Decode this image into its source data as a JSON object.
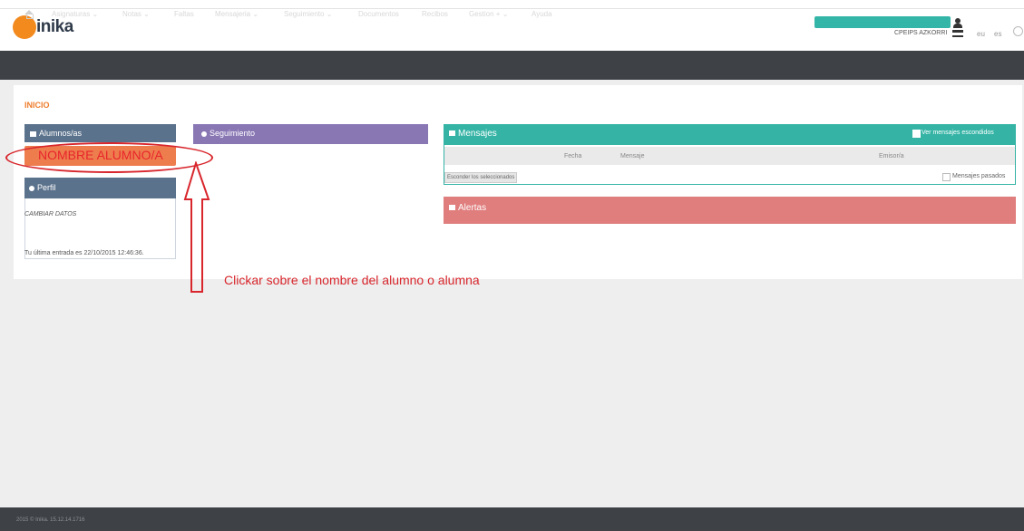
{
  "header": {
    "logo_text": "inika",
    "school": "CPEIPS AZKORRI",
    "lang_eu": "eu",
    "lang_es": "es"
  },
  "nav": {
    "items": [
      "Asignaturas ⌄",
      "Notas ⌄",
      "Faltas",
      "Mensajeria ⌄",
      "Seguimiento ⌄",
      "Documentos",
      "Recibos",
      "Gestion + ⌄",
      "Ayuda"
    ]
  },
  "page": {
    "title": "INICIO"
  },
  "students_panel": {
    "title": "Alumnos/as",
    "student_name": "NOMBRE ALUMNO/A"
  },
  "follow_panel": {
    "title": "Seguimiento"
  },
  "profile_panel": {
    "title": "Perfil",
    "change_link": "CAMBIAR DATOS",
    "last_login": "Tu última entrada es 22/10/2015 12:46:36."
  },
  "messages_panel": {
    "title": "Mensajes",
    "show_hidden_label": "Ver mensajes escondidos",
    "columns": [
      "Fecha",
      "Mensaje",
      "Emisor/a"
    ],
    "hide_selected_label": "Esconder los seleccionados",
    "past_messages_label": "Mensajes pasados"
  },
  "alerts_panel": {
    "title": "Alertas"
  },
  "annotation": {
    "hint": "Clickar sobre el nombre del alumno o alumna"
  },
  "footer": {
    "text": "2015 © Inika. 15.12.14.1716"
  }
}
